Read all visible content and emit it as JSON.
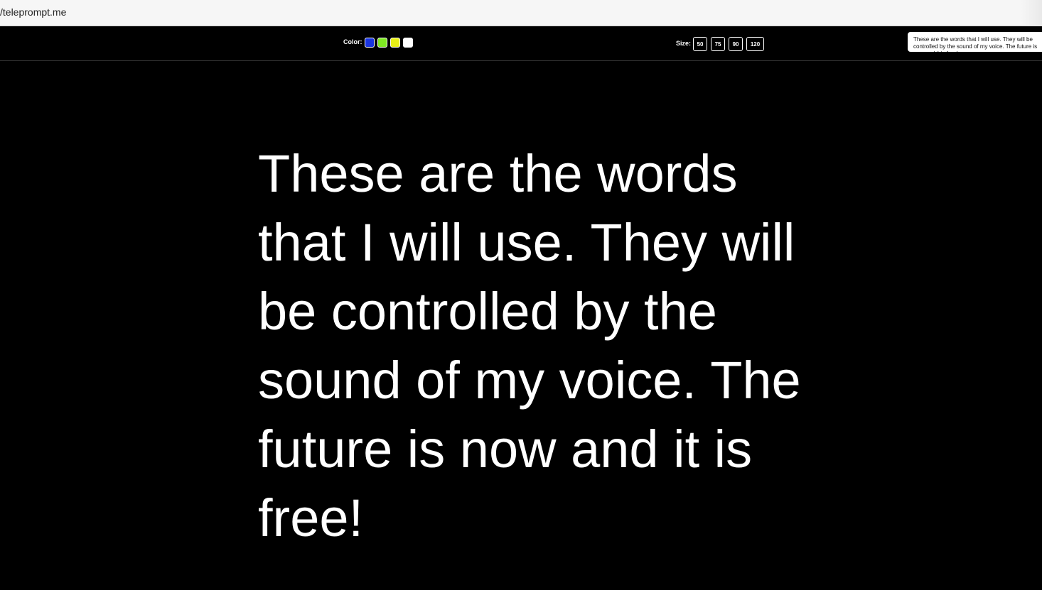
{
  "browser": {
    "url": "/teleprompt.me"
  },
  "toolbar": {
    "color_label": "Color:",
    "colors": [
      {
        "name": "blue",
        "hex": "#1a35e0"
      },
      {
        "name": "green",
        "hex": "#7ee823"
      },
      {
        "name": "yellow",
        "hex": "#e8f016"
      },
      {
        "name": "white",
        "hex": "#ffffff"
      }
    ],
    "size_label": "Size:",
    "sizes": [
      "50",
      "75",
      "90",
      "120"
    ],
    "script_preview": "These are the words that I will use. They will be controlled by the sound of my voice. The future is now and it is free!"
  },
  "prompt": {
    "text": "These are the words that I will use. They will be controlled by the sound of my voice. The future is now and it is free!",
    "color": "#ffffff"
  }
}
